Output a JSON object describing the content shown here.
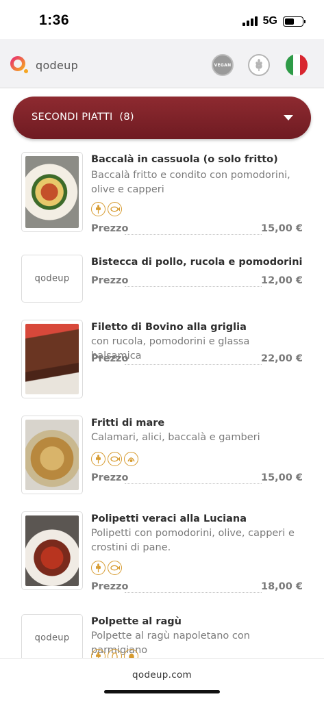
{
  "status": {
    "time": "1:36",
    "network": "5G"
  },
  "header": {
    "logo_text": "qodeup",
    "icons": [
      "vegan-filter-icon",
      "gluten-free-filter-icon",
      "italian-flag-icon"
    ],
    "vegan_badge": "VEGAN"
  },
  "category": {
    "label": "SECONDI PIATTI",
    "count": "(8)"
  },
  "price_label": "Prezzo",
  "placeholder_logo": "qodeup",
  "items": [
    {
      "name": "Baccalà in cassuola (o solo fritto)",
      "desc": "Baccalà fritto e condito con pomodorini, olive e capperi",
      "price": "15,00 €",
      "allergens": [
        "gluten-icon",
        "fish-icon"
      ]
    },
    {
      "name": "Bistecca di pollo, rucola e pomodorini",
      "desc": "",
      "price": "12,00 €",
      "allergens": []
    },
    {
      "name": "Filetto di Bovino alla griglia",
      "desc": "con rucola, pomodorini e glassa balsamica",
      "price": "22,00 €",
      "allergens": []
    },
    {
      "name": "Fritti di mare",
      "desc": "Calamari, alici, baccalà e gamberi",
      "price": "15,00 €",
      "allergens": [
        "gluten-icon",
        "fish-icon",
        "crustacean-icon"
      ]
    },
    {
      "name": "Polipetti veraci alla Luciana",
      "desc": "Polipetti con pomodorini, olive, capperi e crostini di pane.",
      "price": "18,00 €",
      "allergens": [
        "gluten-icon",
        "fish-icon"
      ]
    },
    {
      "name": "Polpette al ragù",
      "desc": "Polpette al ragù napoletano con parmigiano",
      "price": "",
      "allergens": [
        "gluten-icon",
        "dairy-icon",
        "egg-icon"
      ]
    }
  ],
  "footer": {
    "text": "qodeup.com"
  },
  "colors": {
    "accent": "#7d2229",
    "allergen": "#d69a2e",
    "header_bg": "#f2f2f4"
  }
}
